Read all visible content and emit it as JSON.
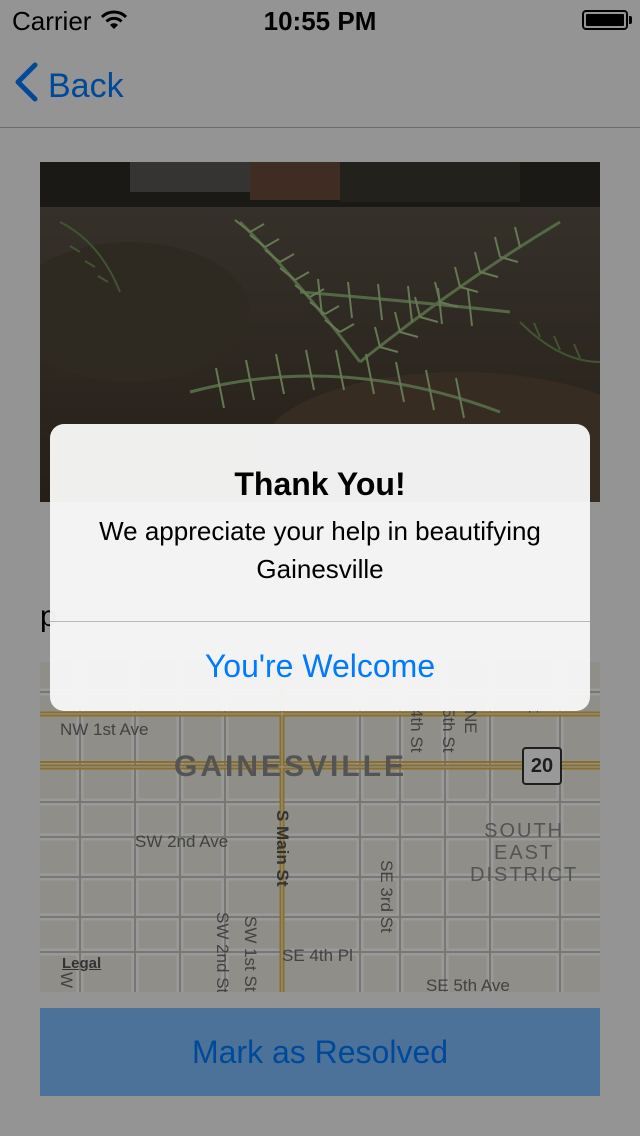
{
  "status_bar": {
    "carrier": "Carrier",
    "time": "10:55 PM"
  },
  "nav": {
    "back_label": "Back"
  },
  "detail": {
    "subtitle_fragment": "p"
  },
  "map": {
    "city_label": "GAINESVILLE",
    "district_label_1": "SOUTH",
    "district_label_2": "EAST",
    "district_label_3": "DISTRICT",
    "streets": {
      "nw_1st_ave": "NW 1st Ave",
      "sw_2nd_ave": "SW 2nd Ave",
      "s_main_st": "S Main St",
      "se_3rd_st": "SE 3rd St",
      "sw_2nd_st": "SW 2nd St",
      "sw_1st_st": "SW 1st St",
      "se_4th_pl": "SE 4th Pl",
      "se_5th_ave": "SE 5th Ave",
      "fourth_st": "4th St",
      "fifth_st": "5th St",
      "ne": "NE",
      "w": "W",
      "t": "t"
    },
    "route_shield": "20",
    "legal": "Legal"
  },
  "actions": {
    "resolve_label": "Mark as Resolved"
  },
  "alert": {
    "title": "Thank You!",
    "message": "We appreciate your help in beautifying Gainesville",
    "button_label": "You're Welcome"
  },
  "colors": {
    "accent": "#007aff",
    "resolve_bg": "#80bfff"
  }
}
